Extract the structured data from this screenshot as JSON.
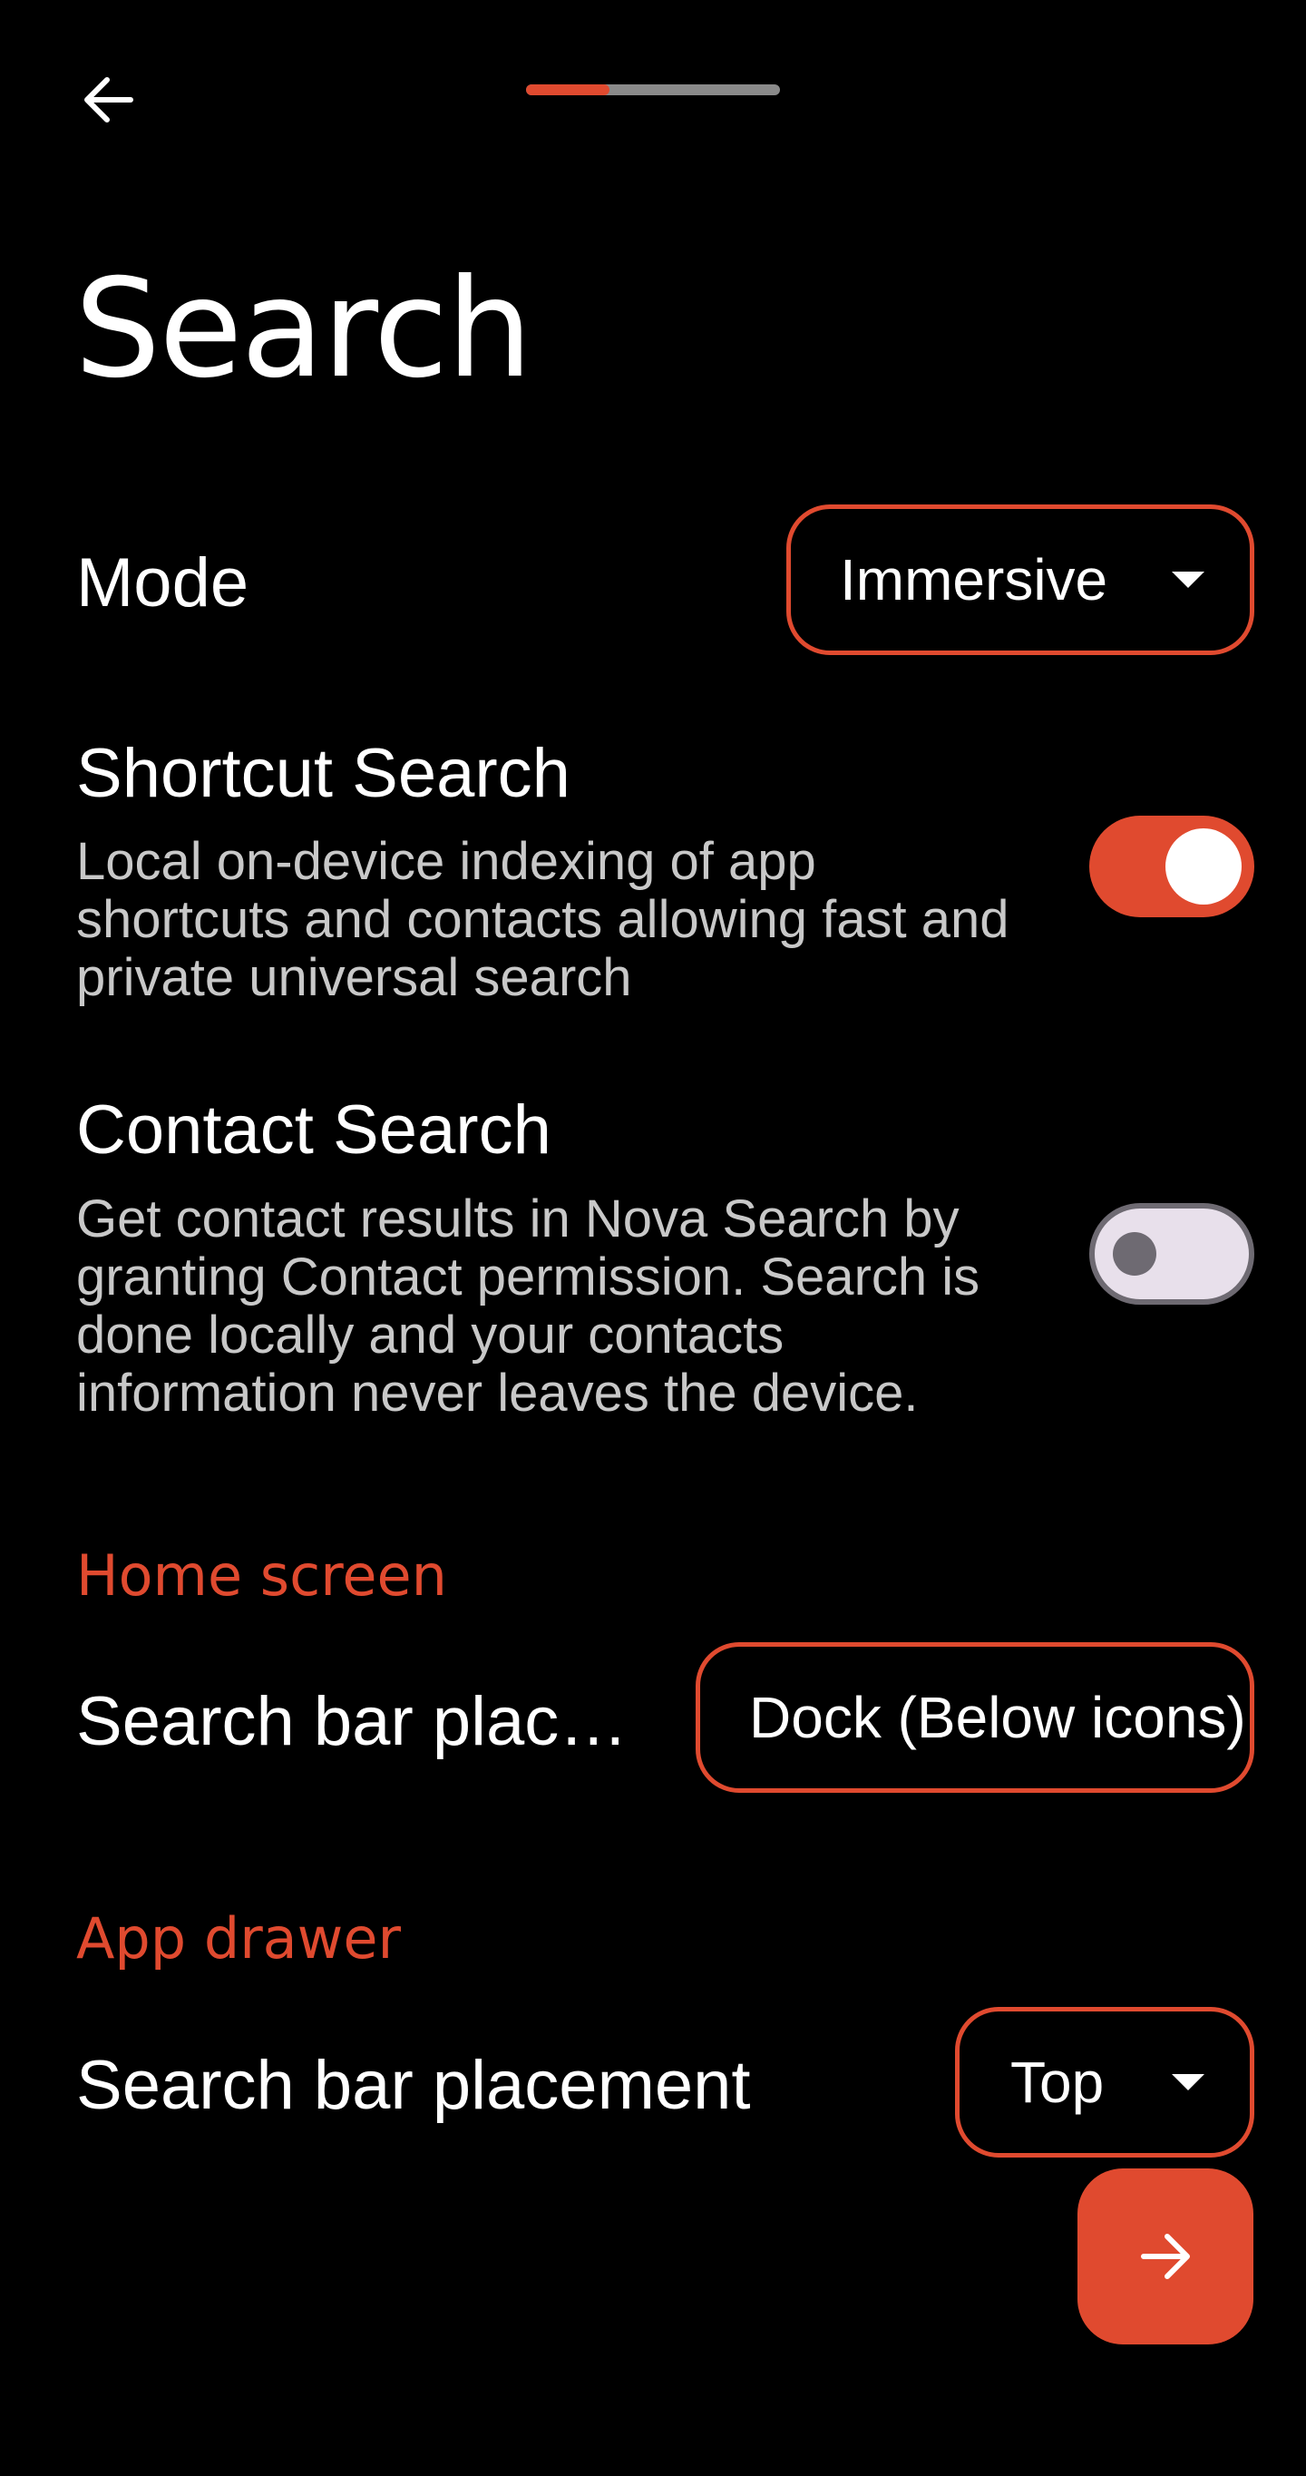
{
  "header": {
    "back_icon": "arrow-left-icon",
    "progress_fraction": 0.33
  },
  "title": "Search",
  "mode": {
    "label": "Mode",
    "selected": "Immersive"
  },
  "shortcut_search": {
    "label": "Shortcut Search",
    "description": "Local on-device indexing of app shortcuts and contacts allowing fast and private universal search",
    "enabled": true
  },
  "contact_search": {
    "label": "Contact Search",
    "description": "Get contact results in Nova Search by granting Contact permission. Search is done locally and your contacts information never leaves the device.",
    "enabled": false
  },
  "home_screen": {
    "section_title": "Home screen",
    "search_bar_label": "Search bar plac…",
    "search_bar_value": "Dock (Below icons)"
  },
  "app_drawer": {
    "section_title": "App drawer",
    "search_bar_label": "Search bar placement",
    "search_bar_value": "Top"
  },
  "fab": {
    "icon": "arrow-right-icon"
  },
  "colors": {
    "accent": "#e04a2f",
    "background": "#000000",
    "text_primary": "#ffffff",
    "text_secondary": "#c8c8c8"
  }
}
